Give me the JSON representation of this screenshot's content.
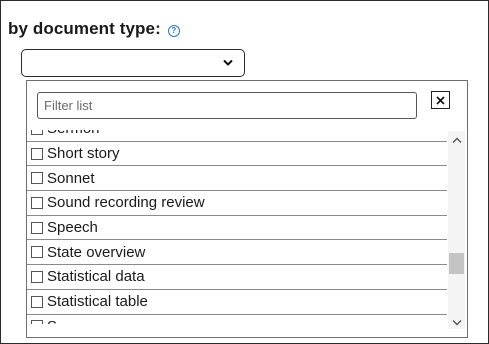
{
  "filter": {
    "heading": "by document type:",
    "help_icon": "?",
    "select_value": "",
    "search": {
      "placeholder": "Filter list",
      "value": ""
    },
    "clear_label": "✕",
    "items": [
      {
        "label": "Sermon",
        "checked": false
      },
      {
        "label": "Short story",
        "checked": false
      },
      {
        "label": "Sonnet",
        "checked": false
      },
      {
        "label": "Sound recording review",
        "checked": false
      },
      {
        "label": "Speech",
        "checked": false
      },
      {
        "label": "State overview",
        "checked": false
      },
      {
        "label": "Statistical data",
        "checked": false
      },
      {
        "label": "Statistical table",
        "checked": false
      },
      {
        "label": "S...",
        "checked": false
      }
    ],
    "scroll_position": 0.72
  }
}
